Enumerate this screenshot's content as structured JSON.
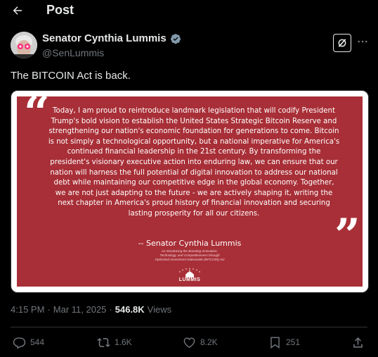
{
  "header": {
    "title": "Post"
  },
  "author": {
    "name": "Senator Cynthia Lummis",
    "handle": "@SenLummis"
  },
  "post": {
    "text": "The BITCOIN Act is back."
  },
  "media": {
    "statement": "Today, I am proud to reintroduce landmark legislation that will codify President Trump's bold vision to establish the United States Strategic Bitcoin Reserve and strengthening our nation's economic foundation for generations to come. Bitcoin is not simply a technological opportunity, but a national imperative for America's continued financial leadership in the 21st century. By transforming the president's visionary executive action into enduring law, we can ensure that our nation will harness the full potential of digital innovation to address our national debt while maintaining our competitive edge in the global economy. Together, we are not just adapting to the future - we are actively shaping it, writing the next chapter in America's proud history of financial innovation and securing lasting prosperity for all our citizens.",
    "signature": "-- Senator Cynthia Lummis",
    "sig_line1": "on Introducing the Boosting Innovation,",
    "sig_line2": "Technology, and Competitiveness through",
    "sig_line3": "Optimized Investment Nationwide (BITCOIN) Act",
    "logo_text": "LUMMIS"
  },
  "meta": {
    "time": "4:15 PM",
    "separator": "·",
    "date": "Mar 11, 2025",
    "separator2": "·",
    "views_count": "546.8K",
    "views_label": "Views"
  },
  "actions": {
    "replies": "544",
    "reposts": "1.6K",
    "likes": "8.2K",
    "bookmarks": "251"
  },
  "icons": {
    "back": "arrow-left-icon",
    "verified": "verified-badge-icon",
    "grok": "grok-icon",
    "more": "more-horizontal-icon",
    "reply": "reply-icon",
    "repost": "repost-icon",
    "like": "heart-icon",
    "bookmark": "bookmark-icon",
    "share": "share-icon"
  },
  "colors": {
    "background": "#000000",
    "card": "#a82f37",
    "verified": "#829aab",
    "muted": "#71767b"
  }
}
